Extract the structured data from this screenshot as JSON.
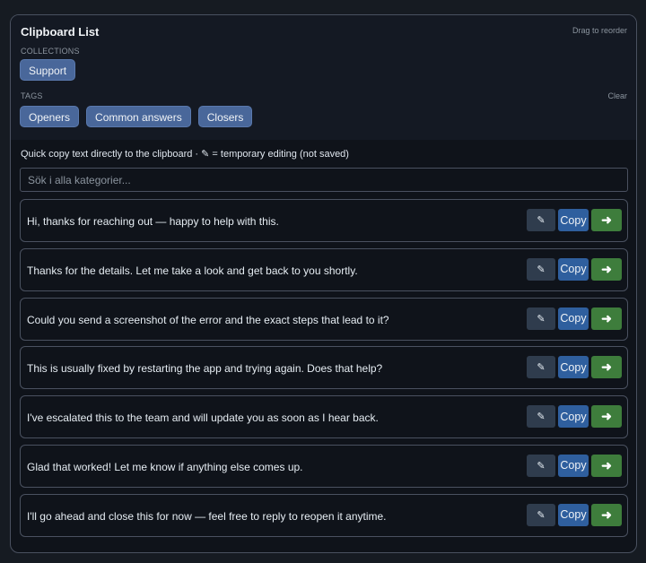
{
  "header": {
    "title": "Clipboard List",
    "drag_hint": "Drag to reorder"
  },
  "collections": {
    "label": "COLLECTIONS",
    "items": [
      "Support"
    ]
  },
  "tags": {
    "label": "TAGS",
    "clear_label": "Clear",
    "items": [
      "Openers",
      "Common answers",
      "Closers"
    ]
  },
  "hint": "Quick copy text directly to the clipboard · ✎ = temporary editing (not saved)",
  "search": {
    "placeholder": "Sök i alla kategorier...",
    "value": ""
  },
  "buttons": {
    "edit_icon": "✎",
    "copy_label": "Copy",
    "go_icon": "➜"
  },
  "snippets": [
    "Hi, thanks for reaching out — happy to help with this.",
    "Thanks for the details. Let me take a look and get back to you shortly.",
    "Could you send a screenshot of the error and the exact steps that lead to it?",
    "This is usually fixed by restarting the app and trying again. Does that help?",
    "I've escalated this to the team and will update you as soon as I hear back.",
    "Glad that worked! Let me know if anything else comes up.",
    "I'll go ahead and close this for now — feel free to reply to reopen it anytime."
  ]
}
